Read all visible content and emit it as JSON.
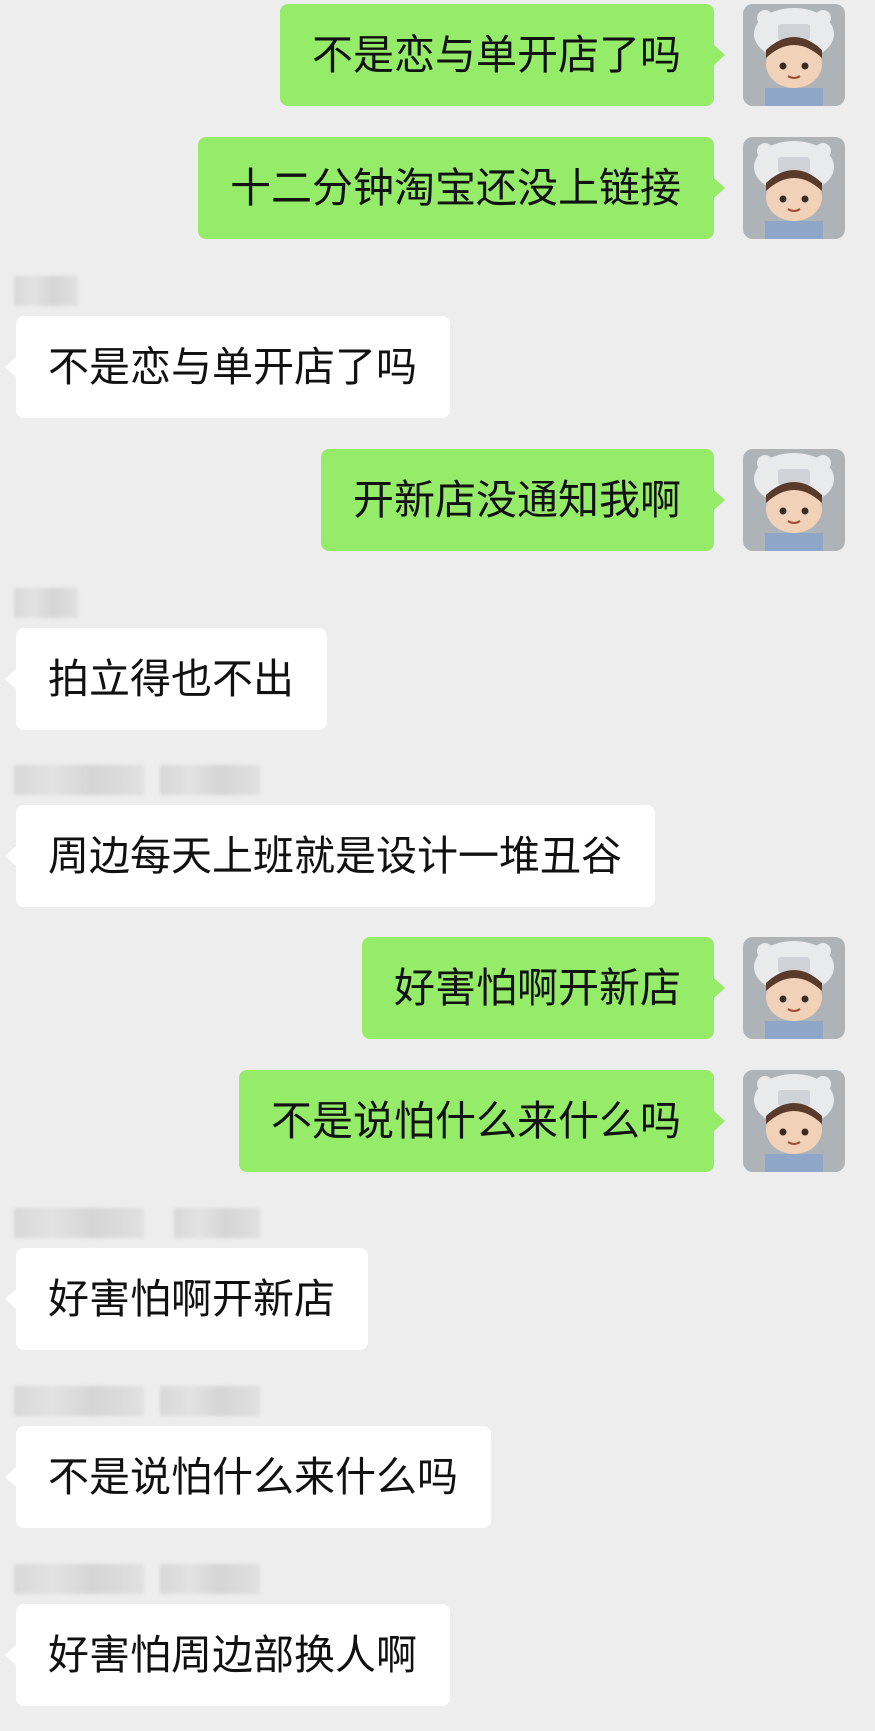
{
  "chat": {
    "messages": [
      {
        "side": "out",
        "text": "不是恋与单开店了吗"
      },
      {
        "side": "out",
        "text": "十二分钟淘宝还没上链接"
      },
      {
        "side": "in",
        "text": "不是恋与单开店了吗"
      },
      {
        "side": "out",
        "text": "开新店没通知我啊"
      },
      {
        "side": "in",
        "text": "拍立得也不出"
      },
      {
        "side": "in",
        "text": "周边每天上班就是设计一堆丑谷"
      },
      {
        "side": "out",
        "text": "好害怕啊开新店"
      },
      {
        "side": "out",
        "text": "不是说怕什么来什么吗"
      },
      {
        "side": "in",
        "text": "好害怕啊开新店"
      },
      {
        "side": "in",
        "text": "不是说怕什么来什么吗"
      },
      {
        "side": "in",
        "text": "好害怕周边部换人啊"
      }
    ]
  },
  "colors": {
    "background": "#ededed",
    "outgoing_bubble": "#95ec69",
    "incoming_bubble": "#ffffff",
    "text": "#111111"
  },
  "icons": {
    "avatar": "user-avatar-doll-with-hat",
    "sender_name": "blurred-sender-name"
  }
}
